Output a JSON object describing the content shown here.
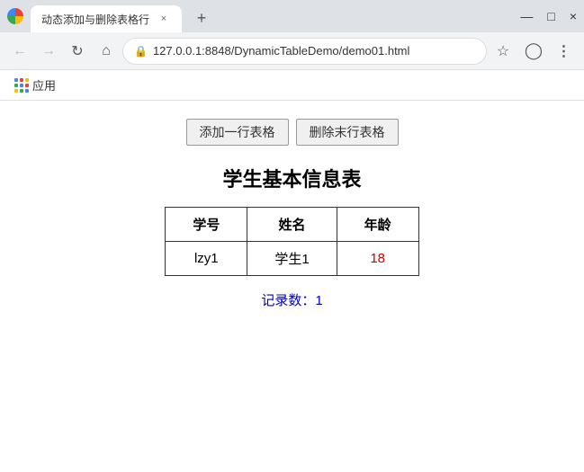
{
  "titleBar": {
    "tabTitle": "动态添加与删除表格行",
    "closeLabel": "×",
    "newTabLabel": "+",
    "winMin": "—",
    "winMax": "□",
    "winClose": "×"
  },
  "addressBar": {
    "url": "127.0.0.1:8848/DynamicTableDemo/demo01.html",
    "lockIcon": "🔒",
    "backIcon": "←",
    "forwardIcon": "→",
    "refreshIcon": "↻",
    "homeIcon": "⌂",
    "starIcon": "☆",
    "accountIcon": "👤",
    "menuIcon": "⋮"
  },
  "bookmarksBar": {
    "appsLabel": "应用"
  },
  "page": {
    "addBtn": "添加一行表格",
    "deleteBtn": "删除末行表格",
    "tableTitle": "学生基本信息表",
    "columns": [
      "学号",
      "姓名",
      "年龄"
    ],
    "rows": [
      {
        "id": "lzy1",
        "name": "学生1",
        "age": "18"
      }
    ],
    "recordLabel": "记录数：",
    "recordCount": "1"
  }
}
